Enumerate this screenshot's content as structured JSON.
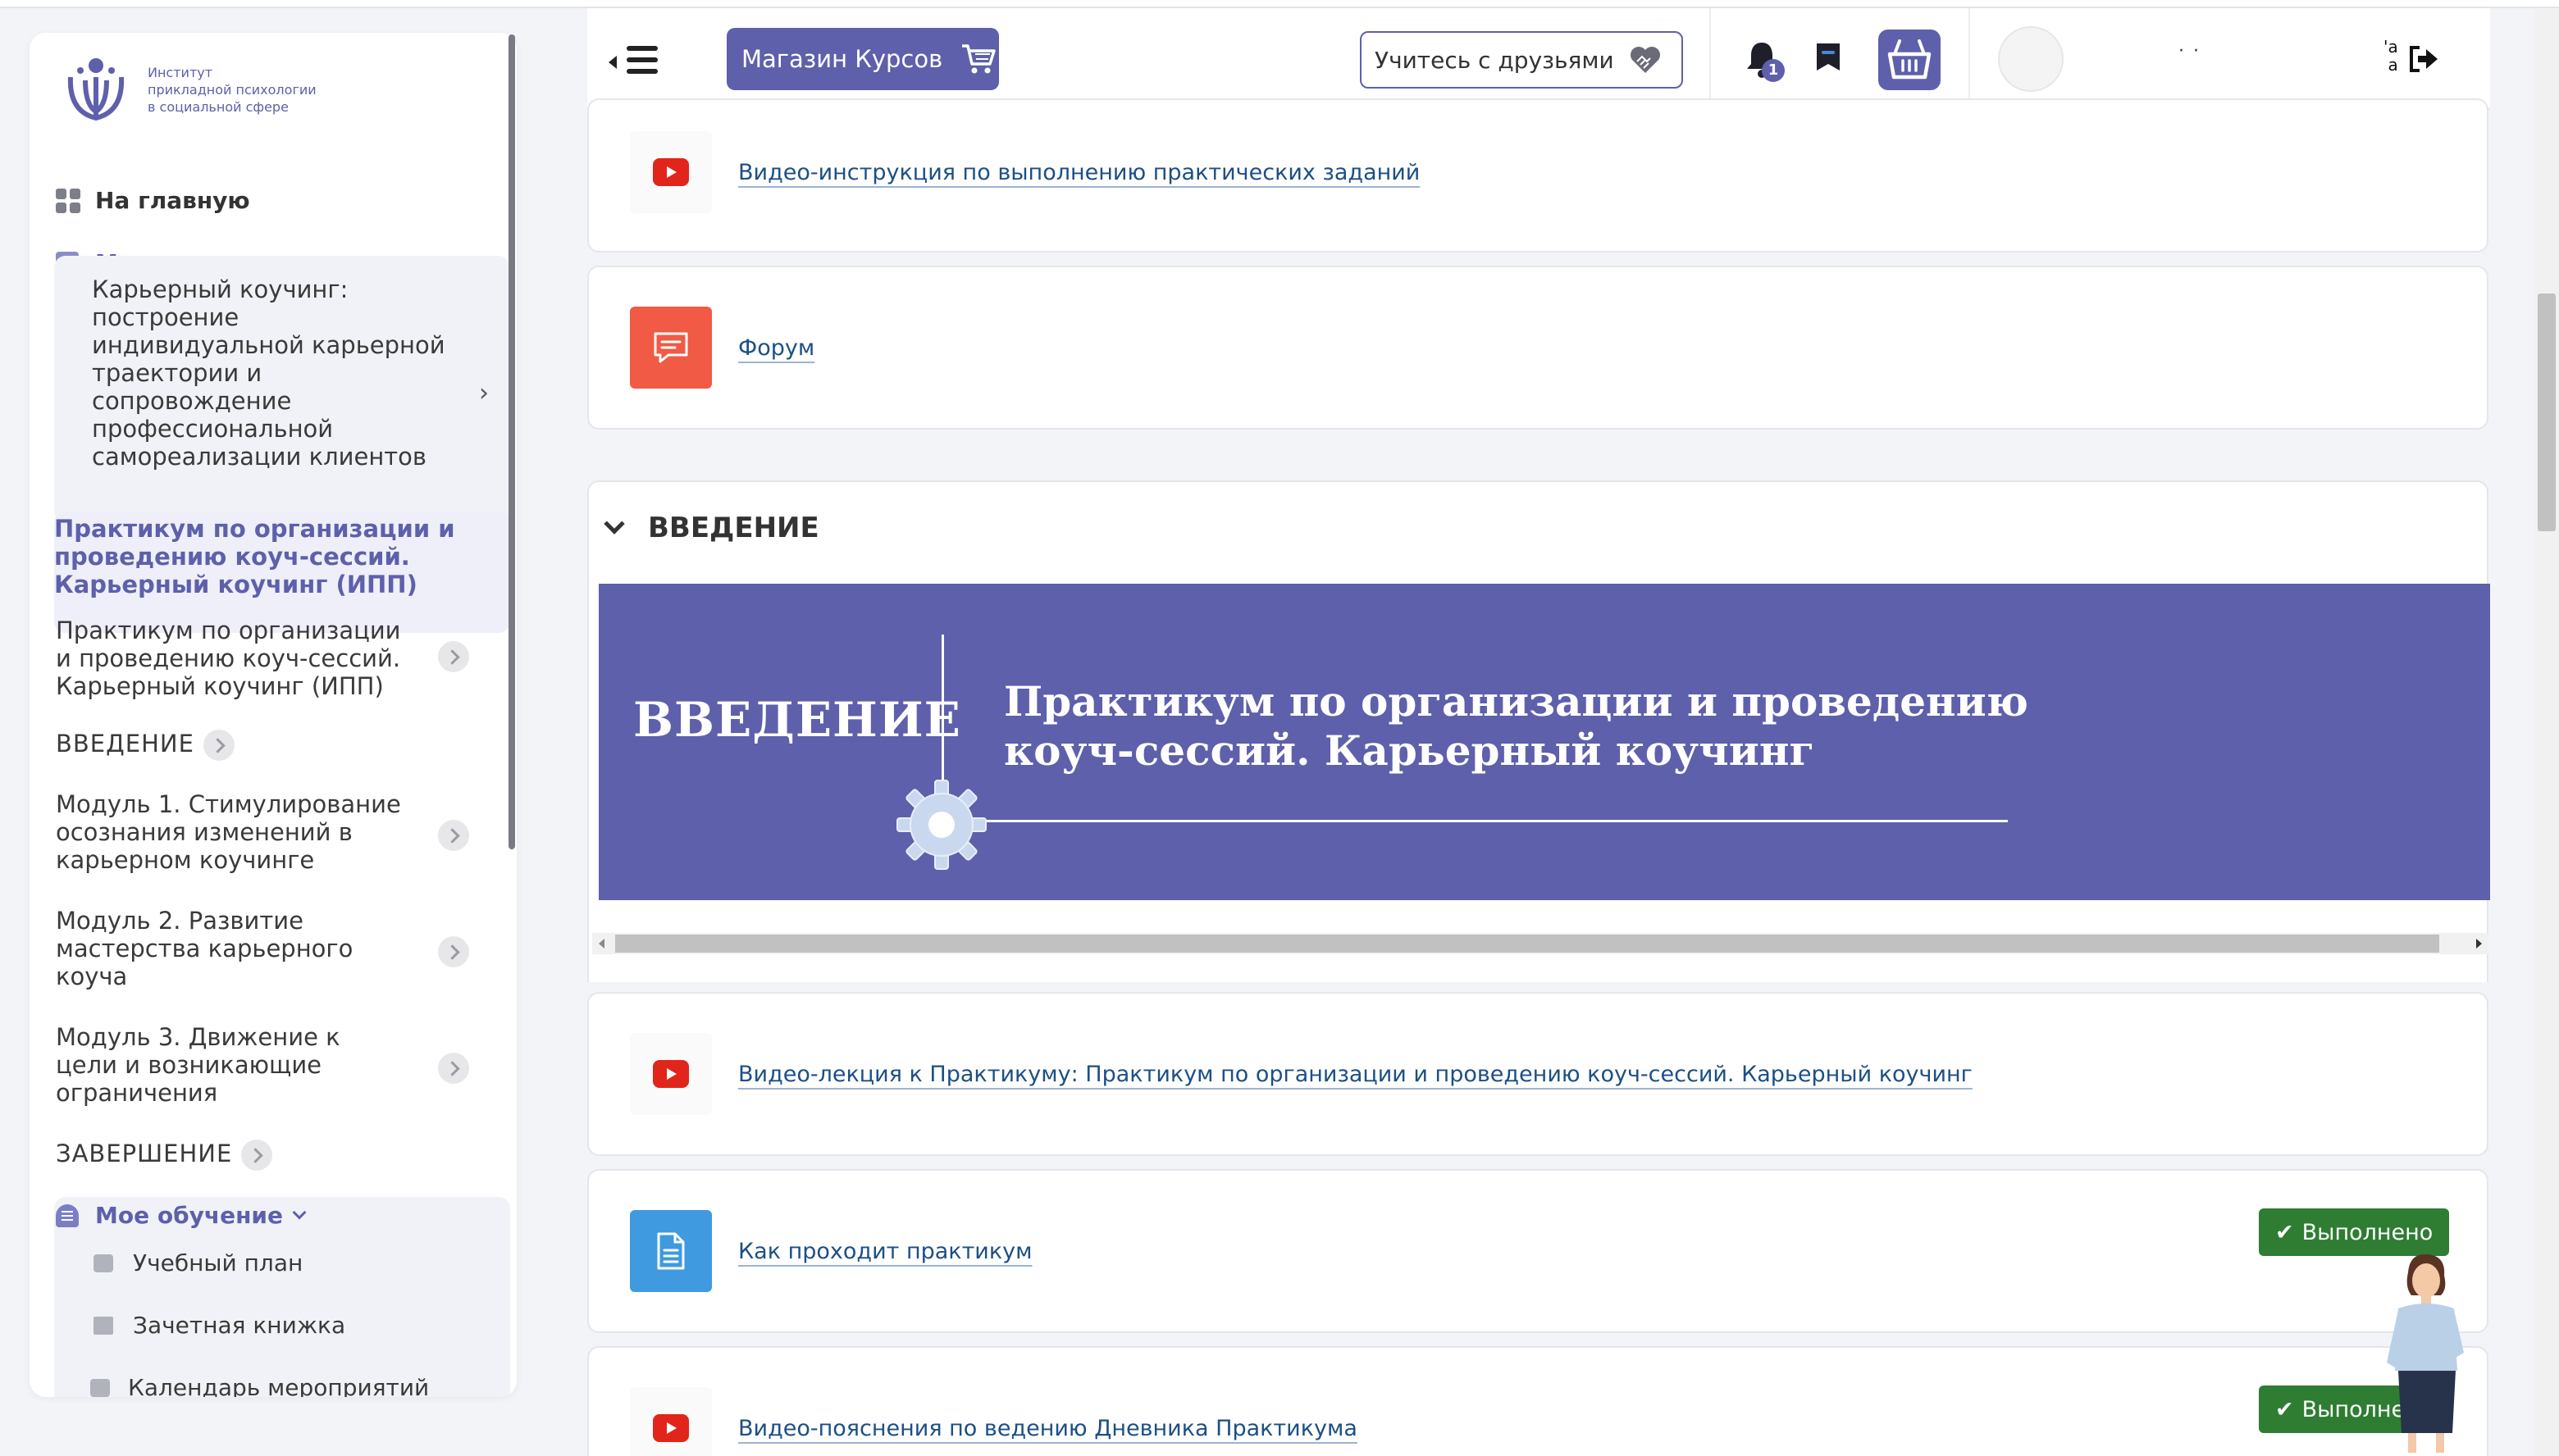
{
  "sidebar": {
    "logo_lines": [
      "Институт",
      "прикладной психологии",
      "в социальной сфере"
    ],
    "home_label": "На главную",
    "my_programs_label": "Мои программы",
    "program_name": "Карьерный коучинг: построение индивидуальной карьерной траектории и сопровождение профессиональной самореализации клиентов",
    "active_course": "Практикум по организации и проведению коуч-сессий. Карьерный коучинг (ИПП)",
    "items": [
      {
        "label": "Практикум по организации и проведению коуч-сессий. Карьерный коучинг (ИПП)"
      },
      {
        "label": "ВВЕДЕНИЕ"
      },
      {
        "label": "Модуль 1. Стимулирование осознания изменений в карьерном коучинге"
      },
      {
        "label": "Модуль 2. Развитие мастерства карьерного коуча"
      },
      {
        "label": "Модуль 3. Движение к цели и возникающие ограничения"
      },
      {
        "label": "ЗАВЕРШЕНИЕ"
      }
    ],
    "my_learning_label": "Мое обучение",
    "learning_items": [
      {
        "label": "Учебный план"
      },
      {
        "label": "Зачетная книжка"
      },
      {
        "label": "Календарь мероприятий"
      }
    ]
  },
  "topbar": {
    "shop_label": "Магазин Курсов",
    "friends_label": "Учитесь с друзьями",
    "notifications_count": "1",
    "user_name_masked": "· ·",
    "lang_top": "'a",
    "lang_bottom": "a"
  },
  "activities_top": [
    {
      "label": "Видео-инструкция по выполнению практических заданий",
      "icon": "youtube-icon"
    },
    {
      "label": "Форум",
      "icon": "forum-icon"
    }
  ],
  "section": {
    "title": "ВВЕДЕНИЕ",
    "banner_left": "ВВЕДЕНИЕ",
    "banner_line1": "Практикум по организации и проведению",
    "banner_line2": "коуч-сессий. Карьерный коучинг"
  },
  "activities": [
    {
      "label": "Видео-лекция к Практикуму: Практикум по организации и проведению коуч-сессий. Карьерный коучинг",
      "icon": "youtube-icon",
      "status": ""
    },
    {
      "label": "Как проходит практикум",
      "icon": "document-icon",
      "status": "Выполнено"
    },
    {
      "label": "Видео-пояснения по ведению Дневника Практикума",
      "icon": "youtube-icon",
      "status": "Выполнено"
    }
  ],
  "colors": {
    "brand": "#5e60ab",
    "done": "#2e7d32",
    "forum": "#f15a45",
    "doc": "#3f9ae0",
    "youtube": "#e1251b"
  }
}
